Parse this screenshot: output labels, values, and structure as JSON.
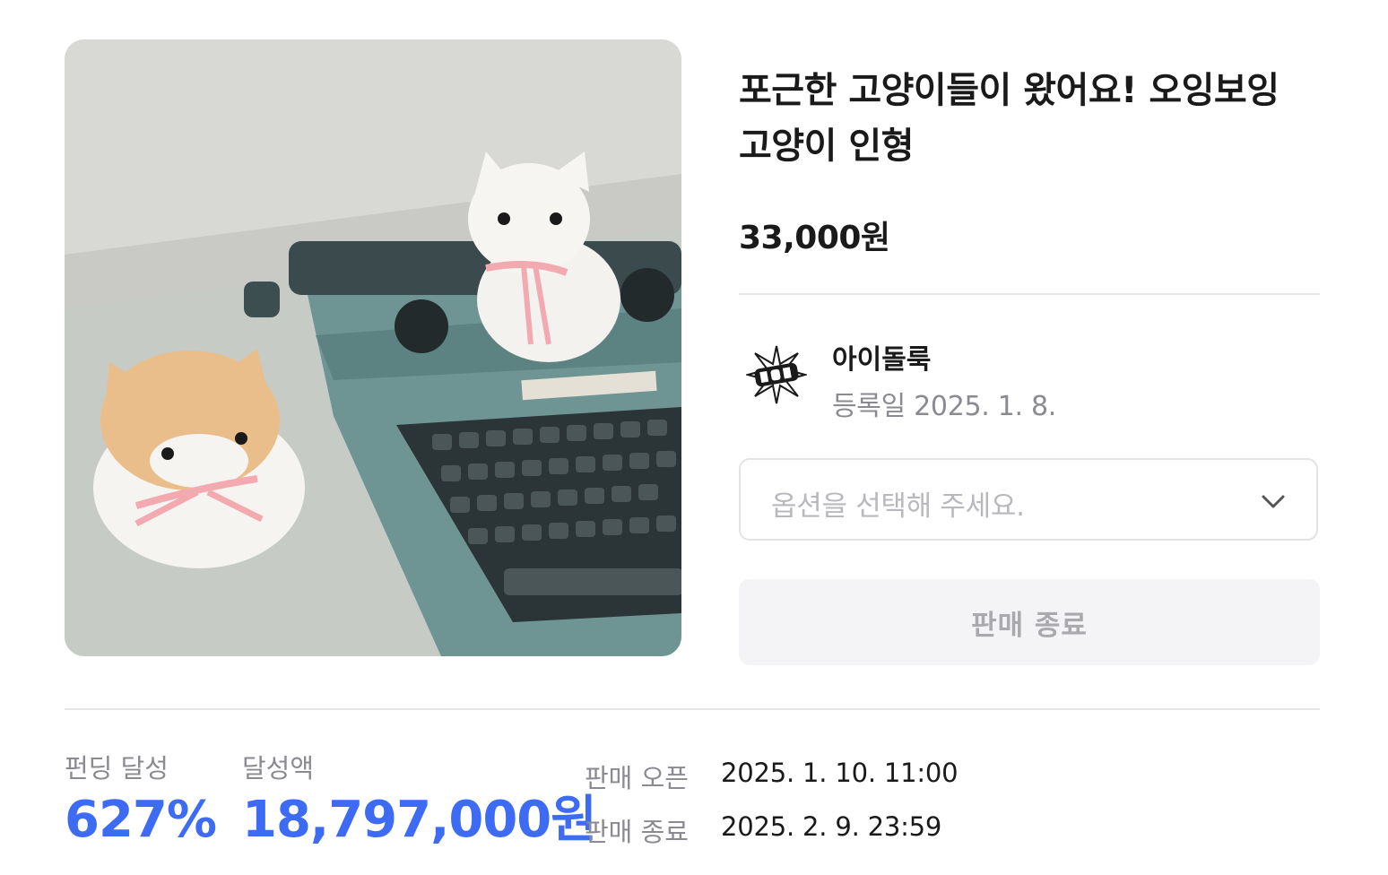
{
  "product": {
    "title": "포근한 고양이들이 왔어요! 오잉보잉 고양이 인형",
    "price": "33,000원",
    "image_alt": "typewriter-with-cat-plush-photo"
  },
  "seller": {
    "name": "아이돌룩",
    "registered": "등록일 2025. 1. 8."
  },
  "option_select": {
    "placeholder": "옵션을 선택해 주세요."
  },
  "purchase_button": {
    "label": "판매 종료"
  },
  "stats": {
    "funding_label": "펀딩 달성",
    "funding_value": "627%",
    "amount_label": "달성액",
    "amount_value": "18,797,000원"
  },
  "schedule": {
    "open_label": "판매 오픈",
    "open_value": "2025. 1. 10. 11:00",
    "close_label": "판매 종료",
    "close_value": "2025. 2. 9. 23:59"
  },
  "colors": {
    "accent": "#3d6bf3",
    "muted_text": "#8a8a90",
    "divider": "#e7e7ea"
  }
}
